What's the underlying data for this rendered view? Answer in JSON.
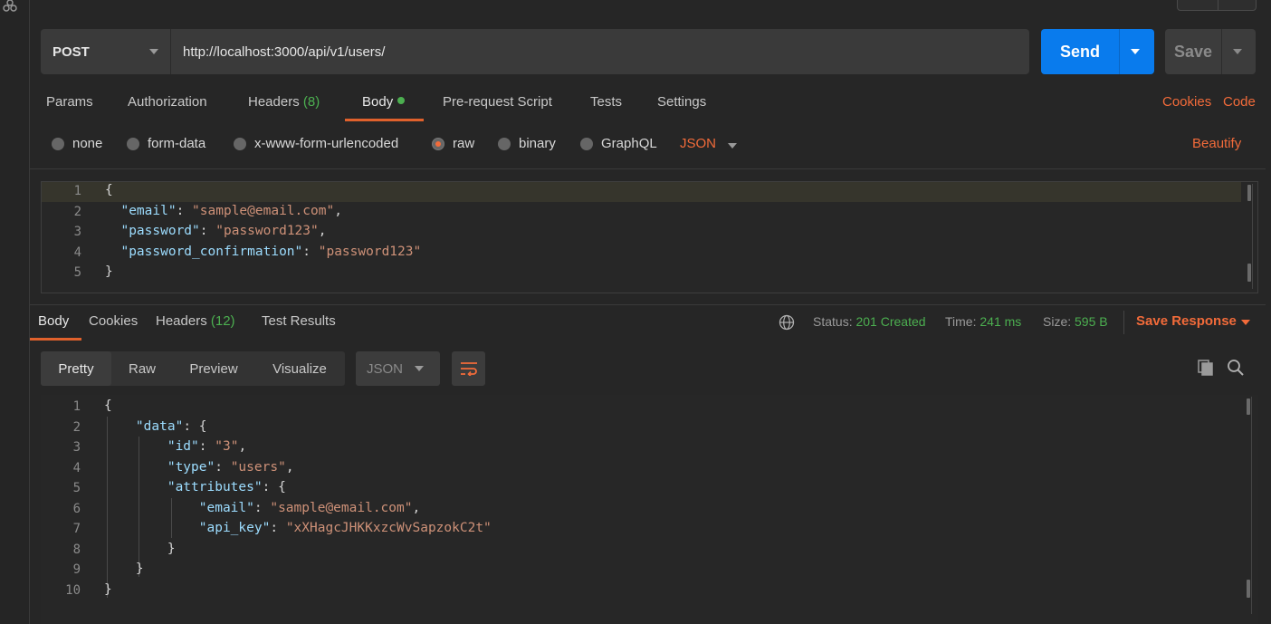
{
  "request": {
    "method": "POST",
    "url": "http://localhost:3000/api/v1/users/",
    "send_label": "Send",
    "save_label": "Save"
  },
  "request_tabs": {
    "params": "Params",
    "authorization": "Authorization",
    "headers": "Headers",
    "headers_count": "(8)",
    "body": "Body",
    "prerequest": "Pre-request Script",
    "tests": "Tests",
    "settings": "Settings",
    "cookies": "Cookies",
    "code": "Code"
  },
  "body_types": {
    "none": "none",
    "form_data": "form-data",
    "urlencoded": "x-www-form-urlencoded",
    "raw": "raw",
    "binary": "binary",
    "graphql": "GraphQL",
    "selected": "raw",
    "language": "JSON",
    "beautify": "Beautify"
  },
  "request_body": {
    "line_numbers": [
      "1",
      "2",
      "3",
      "4",
      "5"
    ],
    "l1": "{",
    "email_key": "\"email\"",
    "email_val": "\"sample@email.com\"",
    "password_key": "\"password\"",
    "password_val": "\"password123\"",
    "pwconf_key": "\"password_confirmation\"",
    "pwconf_val": "\"password123\"",
    "l5": "}"
  },
  "response_tabs": {
    "body": "Body",
    "cookies": "Cookies",
    "headers": "Headers",
    "headers_count": "(12)",
    "test_results": "Test Results"
  },
  "response_meta": {
    "status_label": "Status:",
    "status_value": "201 Created",
    "time_label": "Time:",
    "time_value": "241 ms",
    "size_label": "Size:",
    "size_value": "595 B",
    "save_response": "Save Response"
  },
  "response_view": {
    "pretty": "Pretty",
    "raw": "Raw",
    "preview": "Preview",
    "visualize": "Visualize",
    "format": "JSON"
  },
  "response_body": {
    "line_numbers": [
      "1",
      "2",
      "3",
      "4",
      "5",
      "6",
      "7",
      "8",
      "9",
      "10"
    ],
    "open": "{",
    "data_key": "\"data\"",
    "id_key": "\"id\"",
    "id_val": "\"3\"",
    "type_key": "\"type\"",
    "type_val": "\"users\"",
    "attributes_key": "\"attributes\"",
    "email_key": "\"email\"",
    "email_val": "\"sample@email.com\"",
    "api_key_key": "\"api_key\"",
    "api_key_val": "\"xXHagcJHKKxzcWvSapzokC2t\"",
    "close": "}"
  },
  "colors": {
    "accent_orange": "#f26b3a",
    "send_blue": "#097bed",
    "status_green": "#4caf50",
    "json_key": "#9cdcfe",
    "json_string": "#ce9178"
  }
}
